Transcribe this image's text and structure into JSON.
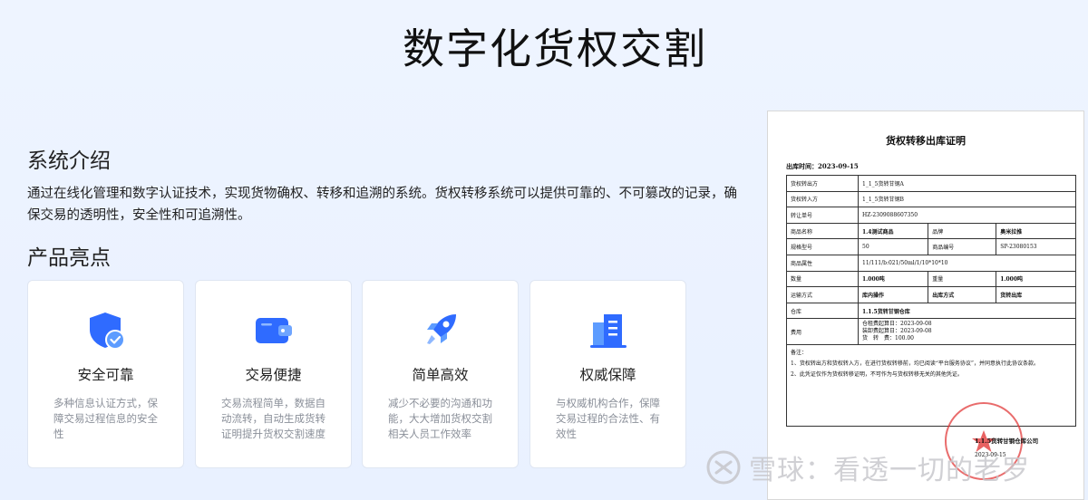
{
  "page": {
    "title": "数字化货权交割"
  },
  "intro": {
    "heading": "系统介绍",
    "text": "通过在线化管理和数字认证技术，实现货物确权、转移和追溯的系统。货权转移系统可以提供可靠的、不可篡改的记录，确保交易的透明性，安全性和可追溯性。"
  },
  "highlights": {
    "heading": "产品亮点",
    "cards": [
      {
        "icon": "shield-check-icon",
        "title": "安全可靠",
        "desc": "多种信息认证方式，保障交易过程信息的安全性"
      },
      {
        "icon": "wallet-icon",
        "title": "交易便捷",
        "desc": "交易流程简单，数据自动流转，自动生成货转证明提升货权交割速度"
      },
      {
        "icon": "rocket-icon",
        "title": "简单高效",
        "desc": "减少不必要的沟通和功能，大大增加货权交割相关人员工作效率"
      },
      {
        "icon": "buildings-icon",
        "title": "权威保障",
        "desc": "与权威机构合作，保障交易过程的合法性、有效性"
      }
    ]
  },
  "document": {
    "title": "货权转移出库证明",
    "date": "出库时间：2023-09-15",
    "rows": [
      [
        "货权转出方",
        "1_1_5货转甘钢A"
      ],
      [
        "货权转入方",
        "1_1_5货转甘钢B"
      ],
      [
        "转让单号",
        "HZ-2309088607350"
      ],
      [
        "商品名称",
        "1.4测试商品",
        "品牌",
        "奥米拉推"
      ],
      [
        "规格型号",
        "50",
        "商品编号",
        "SP-23080153"
      ],
      [
        "商品属性",
        "11/111/b:021/50ml/1/10*10*10"
      ],
      [
        "数量",
        "1.000吨",
        "重量",
        "1.000吨"
      ],
      [
        "运输方式",
        "库内操作",
        "出库方式",
        "货转出库"
      ],
      [
        "仓库",
        "1.1.5货转甘钢仓库"
      ]
    ],
    "fee_label": "费用",
    "fee_lines": [
      "仓租费起算日：2023-09-08",
      "装卸费起算日：2023-09-08",
      "货　转　费：100.00"
    ],
    "notes_title": "备注：",
    "notes": [
      "1、货权转出方和货权转入方，在进行货权转移前，均已阅读“平台服务协议”，并同意执行此协议条款。",
      "2、此凭证仅作为货权转移证明，不可作为与货权转移无关的其他凭证。"
    ],
    "company": "1.1.5货转甘钢仓库公司",
    "company_date": "2023-09-15"
  },
  "watermark": {
    "text": "雪球：看透一切的老罗"
  },
  "colors": {
    "accent": "#2f6bff",
    "accent_light": "#4f8bff",
    "stamp": "#e23b3b"
  }
}
